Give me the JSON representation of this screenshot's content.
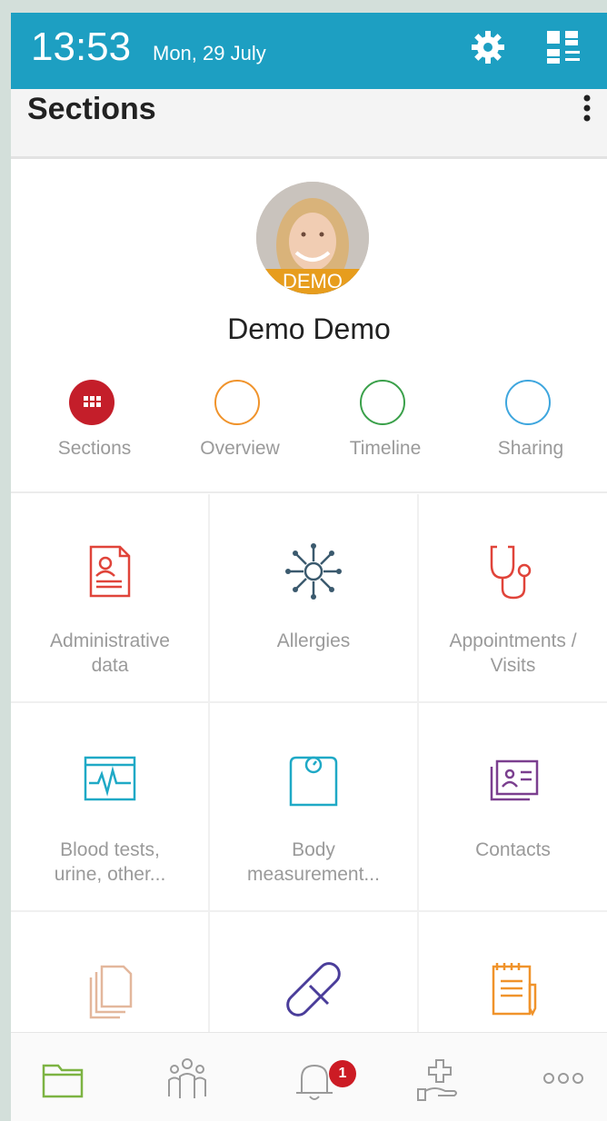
{
  "status_bar": {
    "time": "13:53",
    "date": "Mon, 29 July"
  },
  "app_bar": {
    "title": "Sections"
  },
  "profile": {
    "badge": "DEMO",
    "name": "Demo Demo"
  },
  "tabs": [
    {
      "label": "Sections",
      "color": "#c41e2a",
      "selected": true
    },
    {
      "label": "Overview",
      "color": "#f0932b"
    },
    {
      "label": "Timeline",
      "color": "#3aa04a"
    },
    {
      "label": "Sharing",
      "color": "#3ea6de"
    }
  ],
  "sections": [
    {
      "label": "Administrative\ndata",
      "icon": "id-card-icon",
      "color": "#e0443a"
    },
    {
      "label": "Allergies",
      "icon": "allergen-icon",
      "color": "#3b5a6e"
    },
    {
      "label": "Appointments /\nVisits",
      "icon": "stethoscope-icon",
      "color": "#e0443a"
    },
    {
      "label": "Blood tests,\nurine, other...",
      "icon": "monitor-pulse-icon",
      "color": "#1fa9c6"
    },
    {
      "label": "Body\nmeasurement...",
      "icon": "scale-icon",
      "color": "#1fa9c6"
    },
    {
      "label": "Contacts",
      "icon": "contact-card-icon",
      "color": "#7b3f8f"
    },
    {
      "label": "",
      "icon": "documents-icon",
      "color": "#e3b79c"
    },
    {
      "label": "",
      "icon": "pill-icon",
      "color": "#4a3d9a"
    },
    {
      "label": "",
      "icon": "notepad-icon",
      "color": "#f0932b"
    }
  ],
  "bottom_nav": {
    "items": [
      "folder-icon",
      "people-icon",
      "bell-icon",
      "medical-hand-icon",
      "more-icon"
    ],
    "notification_count": "1"
  }
}
